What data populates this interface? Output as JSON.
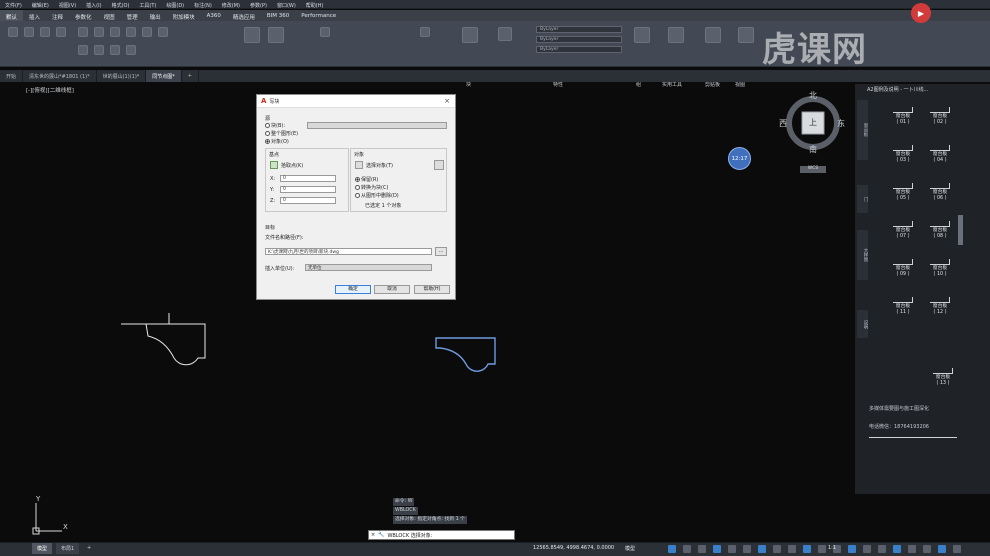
{
  "menubar": [
    "文件(F)",
    "编辑(E)",
    "视图(V)",
    "插入(I)",
    "格式(O)",
    "工具(T)",
    "绘图(D)",
    "标注(N)",
    "修改(M)",
    "参数(P)",
    "窗口(W)",
    "帮助(H)"
  ],
  "ribbon_tabs": [
    "默认",
    "插入",
    "注释",
    "参数化",
    "视图",
    "管理",
    "输出",
    "附加模块",
    "A360",
    "精选应用",
    "BIM 360",
    "Performance"
  ],
  "ribbon": {
    "layer_dropdown": "ByLayer",
    "layer_dropdown2": "ByLayer",
    "layer_dropdown3": "ByLayer",
    "style_dropdown": "副本 (2) ISO-2",
    "panels": [
      "块",
      "特性",
      "组",
      "实用工具",
      "剪贴板",
      "视图"
    ]
  },
  "watermark": "虎课网",
  "doc_tabs": [
    "开始",
    "清东世的展山*#1801 (1)*",
    "世的展山(1)(1)*",
    "同节点图*"
  ],
  "viewport_label": "[-][俯视][二维线框]",
  "viewcube": {
    "north": "北",
    "south": "南",
    "east": "东",
    "west": "西",
    "top": "上",
    "ucs": "WCS"
  },
  "badge": "12:17",
  "dialog": {
    "title": "写块",
    "source_label": "源",
    "source_block": "块(B):",
    "source_whole": "整个图形(E)",
    "source_objects": "对象(O)",
    "basepoint_label": "基点",
    "pick_point": "拾取点(K)",
    "x_label": "X:",
    "y_label": "Y:",
    "z_label": "Z:",
    "x_value": "0",
    "y_value": "0",
    "z_value": "0",
    "objects_label": "对象",
    "select_objects": "选择对象(T)",
    "retain": "保留(R)",
    "convert": "转换为块(C)",
    "delete": "从图形中删除(D)",
    "selected_count": "已选定 1 个对象",
    "target_label": "目标",
    "filename_label": "文件名和路径(F):",
    "filename_value": "K:\\虎课网\\九月\\世的项目\\新块.dwg",
    "units_label": "插入单位(U):",
    "units_value": "无单位",
    "ok": "确定",
    "cancel": "取消",
    "help": "帮助(H)"
  },
  "right_panel": {
    "title": "A2图例及说明 - 一卜川线...",
    "tabs": [
      "窗台板",
      "门",
      "大样图",
      "说明"
    ],
    "blocks": [
      {
        "name": "窗台板",
        "num": "( 01 )"
      },
      {
        "name": "窗台板",
        "num": "( 02 )"
      },
      {
        "name": "窗台板",
        "num": "( 03 )"
      },
      {
        "name": "窗台板",
        "num": "( 04 )"
      },
      {
        "name": "窗台板",
        "num": "( 05 )"
      },
      {
        "name": "窗台板",
        "num": "( 06 )"
      },
      {
        "name": "窗台板",
        "num": "( 07 )"
      },
      {
        "name": "窗台板",
        "num": "( 08 )"
      },
      {
        "name": "窗台板",
        "num": "( 09 )"
      },
      {
        "name": "窗台板",
        "num": "( 10 )"
      },
      {
        "name": "窗台板",
        "num": "( 11 )"
      },
      {
        "name": "窗台板",
        "num": "( 12 )"
      },
      {
        "name": "窗台板",
        "num": "( 13 )"
      }
    ],
    "note1": "多媒体需要图与施工图深化",
    "note2": "电话微信：18764193206"
  },
  "command": {
    "history": [
      "命令: W",
      "WBLOCK",
      "选择对象: 指定对角点: 找到 1 个"
    ],
    "prompt": "WBLOCK 选择对象:"
  },
  "layout_tabs": [
    "模型",
    "布局1"
  ],
  "coords": "12565.8549, 4998.4674, 0.0000",
  "model_label": "模型",
  "scale": "1:1"
}
